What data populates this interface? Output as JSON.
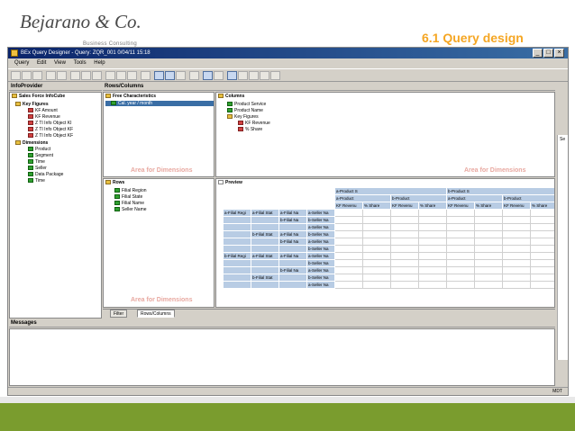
{
  "slide": {
    "logo_name": "Bejarano & Co.",
    "logo_sub": "Business Consulting",
    "title": "6.1 Query design"
  },
  "window": {
    "title": "BEx Query Designer - Query: ZQR_001 0/04/11 15:18",
    "menu": [
      "Query",
      "Edit",
      "View",
      "Tools",
      "Help"
    ]
  },
  "infoprovider": {
    "header": "InfoProvider",
    "cube": "Sales Force InfoCube",
    "key_figures_label": "Key Figures",
    "key_figures": [
      "KF Amount",
      "KF Revenue",
      "Z TI Info Object KI",
      "Z TI Info Object KF",
      "Z TI Info Object KF"
    ],
    "dimensions_label": "Dimensions",
    "dimensions": [
      "Product",
      "Segment",
      "Time",
      "Seller",
      "Data Package",
      "Time"
    ]
  },
  "rowscols": {
    "header": "Rows/Columns",
    "free_char_label": "Free Characteristics",
    "free_char_items": [
      "Cal. year / month"
    ],
    "columns_label": "Columns",
    "columns_items": [
      "Product Service",
      "Product Name",
      "Key Figures",
      "KF Revenue",
      "% Share"
    ],
    "rows_label": "Rows",
    "rows_items": [
      "Filial Region",
      "Filial State",
      "Filial Name",
      "Seller Name"
    ],
    "preview_label": "Preview",
    "area_for_dimensions": "Area for Dimensions"
  },
  "preview": {
    "top_headers": [
      "a-Product S",
      "b-Product S"
    ],
    "mid_headers": [
      "a-Product",
      "b-Product",
      "a-Product",
      "b-Product"
    ],
    "kf_headers": [
      "KF Revenu",
      "% Share",
      "KF Revenu",
      "% Share",
      "KF Revenu",
      "% Share",
      "KF Revenu",
      "% Share"
    ],
    "row_c1": [
      "a-Filial Regi",
      "",
      "",
      "",
      "",
      "",
      "b-Filial Regi",
      "",
      "",
      "",
      ""
    ],
    "row_c2": [
      "a-Filial Stat",
      "",
      "",
      "b-Filial Stat",
      "",
      "",
      "a-Filial Stat",
      "",
      "",
      "b-Filial Stat",
      ""
    ],
    "row_c3": [
      "a-Filial Na",
      "b-Filial Na",
      "",
      "a-Filial Na",
      "b-Filial Na",
      "",
      "a-Filial Na",
      "",
      "b-Filial Na",
      "",
      ""
    ],
    "row_c4": [
      "a-Seller Na",
      "b-Seller Na",
      "a-Seller Na",
      "b-Seller Na",
      "a-Seller Na",
      "b-Seller Na",
      "a-Seller Na",
      "b-Seller Na",
      "a-Seller Na",
      "b-Seller Na",
      "a-Seller Na"
    ]
  },
  "tabs": [
    "Filter",
    "Rows/Columns"
  ],
  "messages": {
    "header": "Messages"
  },
  "status": {
    "text": "MDT"
  },
  "right_edge_text": "Se",
  "colors": {
    "accent": "#f5a623",
    "footer": "#7a9c2e",
    "header_blue": "#b8cce4"
  }
}
